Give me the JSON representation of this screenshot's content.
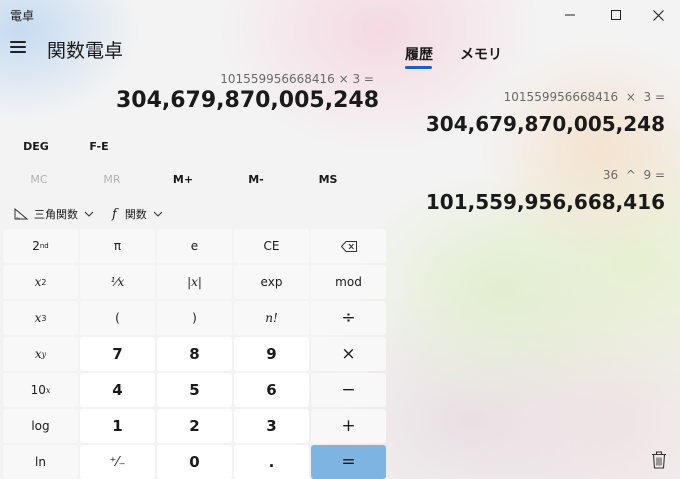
{
  "window": {
    "title": "電卓"
  },
  "header": {
    "mode_title": "関数電卓"
  },
  "display": {
    "expression": "101559956668416 × 3 =",
    "result": "304,679,870,005,248"
  },
  "tabs": [
    {
      "label": "履歴",
      "active": true
    },
    {
      "label": "メモリ",
      "active": false
    }
  ],
  "history": [
    {
      "expression": "101559956668416  ×  3 =",
      "result": "304,679,870,005,248"
    },
    {
      "expression": "36  ^  9 =",
      "result": "101,559,956,668,416"
    }
  ],
  "controls": {
    "deg": "DEG",
    "fe": "F-E",
    "memory": [
      {
        "label": "MC",
        "enabled": false
      },
      {
        "label": "MR",
        "enabled": false
      },
      {
        "label": "M+",
        "enabled": true
      },
      {
        "label": "M-",
        "enabled": true
      },
      {
        "label": "MS",
        "enabled": true
      }
    ]
  },
  "toolbar": {
    "trig": "三角関数",
    "func": "関数"
  },
  "keys": {
    "second": "2",
    "second_sup": "nd",
    "pi": "π",
    "e": "e",
    "ce": "CE",
    "sq_base": "x",
    "sq_exp": "2",
    "inv": "¹⁄x",
    "abs": "|x|",
    "exp": "exp",
    "mod": "mod",
    "cube_base": "x",
    "cube_exp": "3",
    "lparen": "(",
    "rparen": ")",
    "fact": "n!",
    "div": "÷",
    "pow_base": "x",
    "pow_exp": "y",
    "n7": "7",
    "n8": "8",
    "n9": "9",
    "mul": "×",
    "ten_base": "10",
    "ten_exp": "x",
    "n4": "4",
    "n5": "5",
    "n6": "6",
    "minus": "−",
    "log": "log",
    "n1": "1",
    "n2": "2",
    "n3": "3",
    "plus": "+",
    "ln": "ln",
    "negate": "⁺⁄₋",
    "n0": "0",
    "dot": ".",
    "equals": "="
  },
  "colors": {
    "accent": "#1565c0",
    "equals_bg": "#7eb4e2"
  }
}
